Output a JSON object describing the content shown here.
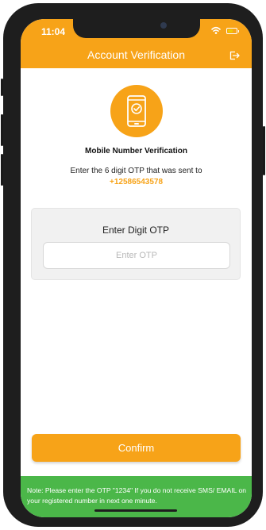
{
  "status_bar": {
    "time": "11:04"
  },
  "header": {
    "title": "Account Verification"
  },
  "verification": {
    "title": "Mobile Number Verification",
    "instruction": "Enter the 6 digit OTP that was sent to",
    "phone_number": "+12586543578"
  },
  "otp_card": {
    "label": "Enter Digit OTP",
    "input_value": "",
    "input_placeholder": "Enter OTP"
  },
  "actions": {
    "confirm_label": "Confirm"
  },
  "footer": {
    "note": "Note: Please enter the OTP \"1234\" If you do not receive SMS/ EMAIL on your registered number in next one minute."
  },
  "colors": {
    "accent": "#f7a318",
    "note_bg": "#4bb749",
    "text": "#222222"
  },
  "icons": {
    "status": [
      "wifi-icon",
      "battery-icon"
    ],
    "header": "logout-icon",
    "badge": "mobile-check-icon"
  }
}
